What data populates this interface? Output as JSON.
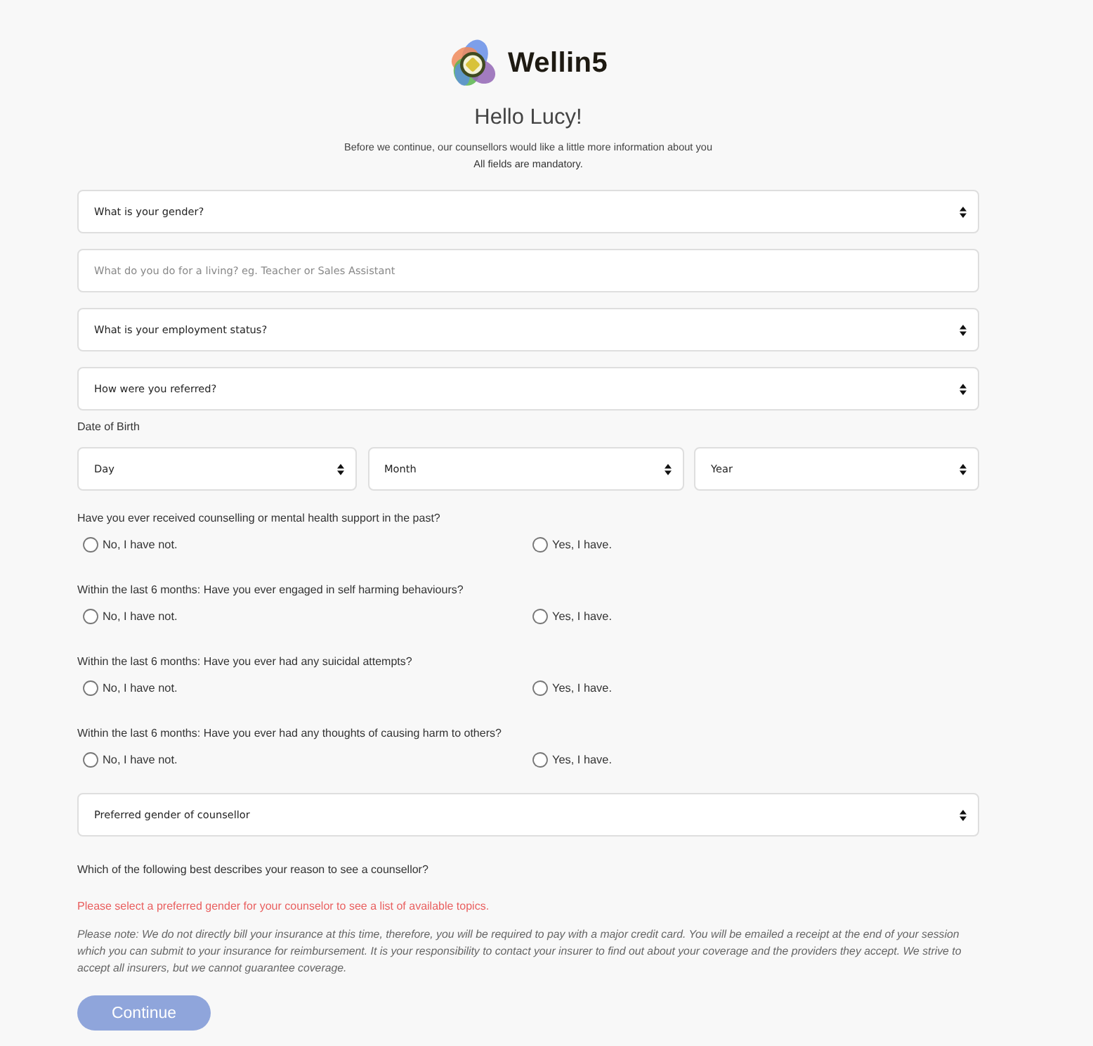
{
  "logo": {
    "name": "Wellin5"
  },
  "heading": "Hello Lucy!",
  "intro": "Before we continue, our counsellors would like a little more information about you",
  "mandatory_note": "All fields are mandatory.",
  "fields": [
    {
      "kind": "select",
      "value": "What is your gender?"
    },
    {
      "kind": "text",
      "placeholder": "What do you do for a living? eg. Teacher or Sales Assistant"
    },
    {
      "kind": "select",
      "value": "What is your employment status?"
    },
    {
      "kind": "select",
      "value": "How were you referred?"
    }
  ],
  "date_of_birth": {
    "label": "Date of Birth",
    "selects": [
      {
        "value": "Day"
      },
      {
        "value": "Month"
      },
      {
        "value": "Year"
      }
    ]
  },
  "questions": [
    {
      "text": "Have you ever received counselling or mental health support in the past?",
      "options": [
        {
          "label": "No, I have not.",
          "selected": false
        },
        {
          "label": "Yes, I have.",
          "selected": false
        }
      ]
    },
    {
      "text": "Within the last 6 months: Have you ever engaged in self harming behaviours?",
      "options": [
        {
          "label": "No, I have not.",
          "selected": false
        },
        {
          "label": "Yes, I have.",
          "selected": false
        }
      ]
    },
    {
      "text": "Within the last 6 months: Have you ever had any suicidal attempts?",
      "options": [
        {
          "label": "No, I have not.",
          "selected": false
        },
        {
          "label": "Yes, I have.",
          "selected": false
        }
      ]
    },
    {
      "text": "Within the last 6 months: Have you ever had any thoughts of causing harm to others?",
      "options": [
        {
          "label": "No, I have not.",
          "selected": false
        },
        {
          "label": "Yes, I have.",
          "selected": false
        }
      ]
    }
  ],
  "counsellor_gender": {
    "value": "Preferred gender of counsellor"
  },
  "reason_question": "Which of the following best describes your reason to see a counsellor?",
  "error": "Please select a preferred gender for your counselor to see a list of available topics.",
  "note": "Please note: We do not directly bill your insurance at this time, therefore, you will be required to pay with a major credit card. You will be emailed a receipt at the end of your session which you can submit to your insurance for reimbursement. It is your responsibility to contact your insurer to find out about your coverage and the providers they accept. We strive to accept all insurers, but we cannot guarantee coverage.",
  "continue_button": {
    "label": "Continue",
    "disabled": true
  }
}
